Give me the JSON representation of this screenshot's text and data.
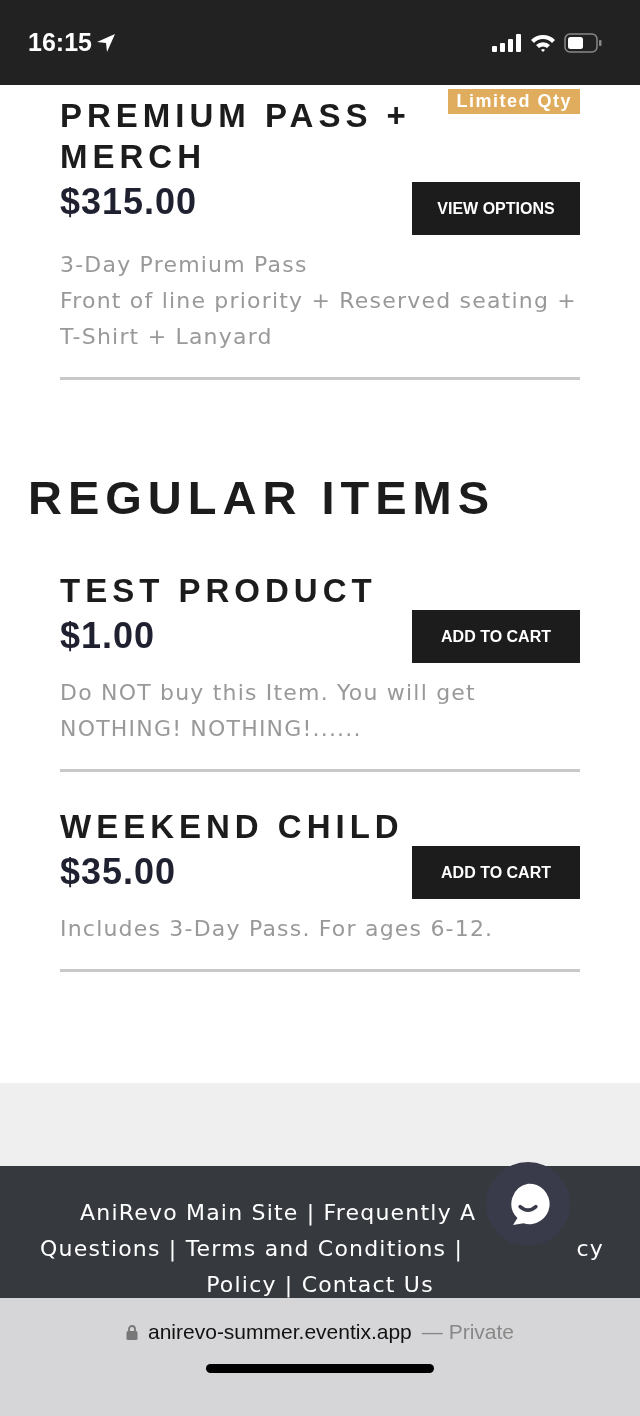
{
  "status_bar": {
    "time": "16:15"
  },
  "sections": [
    {
      "products": [
        {
          "name": "PREMIUM PASS + MERCH",
          "price": "$315.00",
          "badge": "Limited Qty",
          "button": "VIEW OPTIONS",
          "description": [
            "3-Day Premium Pass",
            "Front of line priority + Reserved seating + T-Shirt + Lanyard"
          ]
        }
      ]
    },
    {
      "heading": "REGULAR ITEMS",
      "products": [
        {
          "name": "TEST PRODUCT",
          "price": "$1.00",
          "button": "ADD TO CART",
          "description": [
            "Do NOT buy this Item. You will get NOTHING! NOTHING!......"
          ]
        },
        {
          "name": "WEEKEND CHILD",
          "price": "$35.00",
          "button": "ADD TO CART",
          "description": [
            "Includes 3-Day Pass. For ages 6-12."
          ]
        }
      ]
    }
  ],
  "footer": {
    "lines": [
      [
        "AniRevo Main Site | Frequently A"
      ],
      [
        "Questions | Terms and Conditions |",
        "cy"
      ],
      [
        "Policy | Contact Us"
      ]
    ]
  },
  "address_bar": {
    "url": "anirevo-summer.eventix.app",
    "suffix": "— Private"
  }
}
